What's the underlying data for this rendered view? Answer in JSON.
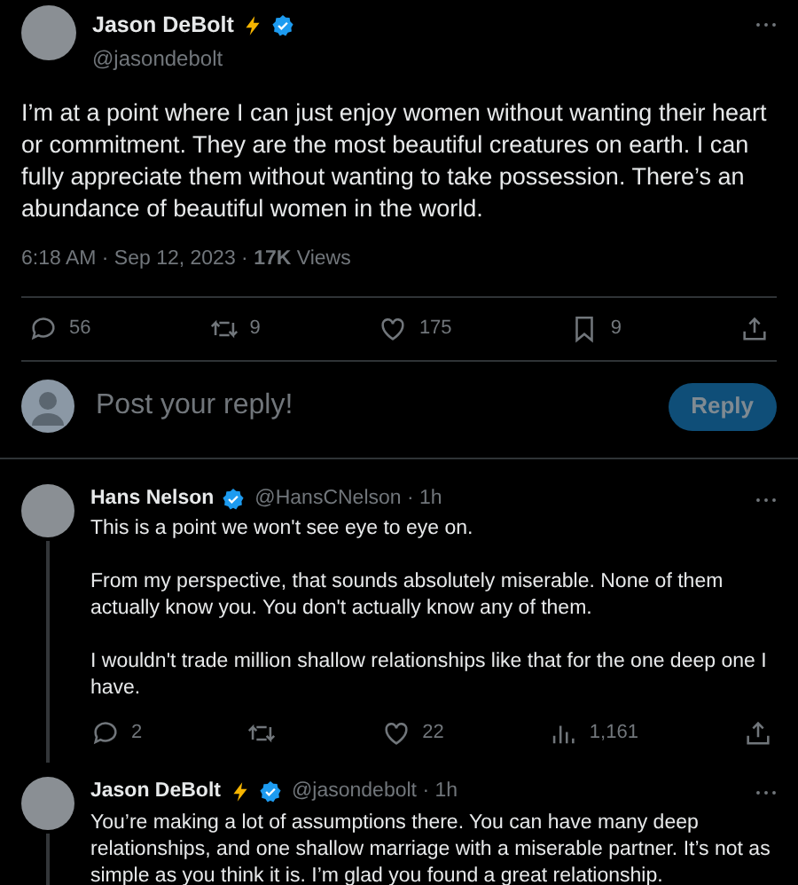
{
  "tweet": {
    "author": {
      "name": "Jason DeBolt",
      "handle": "@jasondebolt",
      "lightning": true,
      "verified": true
    },
    "text": "I’m at a point where I can just enjoy women without wanting their heart or commitment. They are the most beautiful creatures on earth. I can fully appreciate them without wanting to take possession. There’s an abundance of beautiful women in the world.",
    "meta": "6:18 AM · Sep 12, 2023 · **17K** Views",
    "actions": [
      {
        "kind": "reply",
        "count": "56"
      },
      {
        "kind": "repost",
        "count": "9"
      },
      {
        "kind": "like",
        "count": "175"
      },
      {
        "kind": "bookmark",
        "count": "9"
      },
      {
        "kind": "share"
      }
    ]
  },
  "composer": {
    "placeholder": "Post your reply!",
    "button": "Reply"
  },
  "replies": [
    {
      "name": "Hans Nelson",
      "handle": "@HansCNelson · 1h",
      "lightning": false,
      "verified": true,
      "paragraphs": [
        "This is a point we won't see eye to eye on.",
        "From my perspective, that sounds absolutely miserable. None of them actually know you. You don't actually know any of them.",
        "I wouldn't trade million shallow relationships like that for the one deep one I have."
      ],
      "actions": [
        {
          "kind": "reply",
          "count": "2"
        },
        {
          "kind": "repost"
        },
        {
          "kind": "like",
          "count": "22"
        },
        {
          "kind": "views",
          "count": "1,161"
        },
        {
          "kind": "share"
        }
      ]
    },
    {
      "name": "Jason DeBolt",
      "handle": "@jasondebolt · 1h",
      "lightning": true,
      "verified": true,
      "paragraphs": [
        "You’re making a lot of assumptions there. You can have many deep relationships, and one shallow marriage with a miserable partner. It’s not as simple as you think it is. I’m glad you found a great relationship."
      ]
    }
  ]
}
